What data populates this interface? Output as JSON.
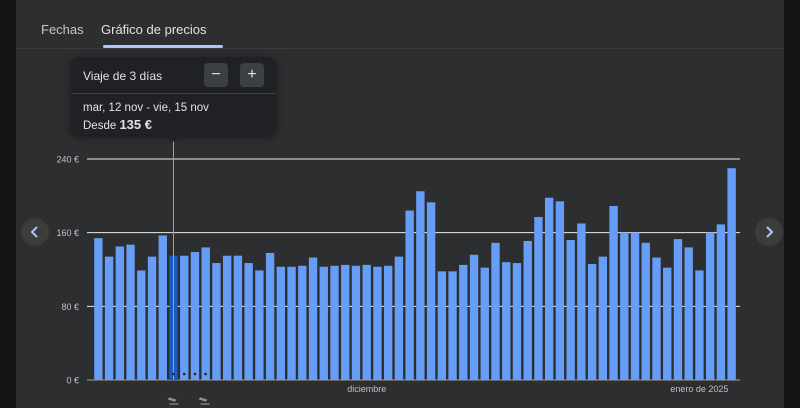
{
  "tabs": [
    {
      "label": "Fechas"
    },
    {
      "label": "Gráfico de precios"
    }
  ],
  "tooltip": {
    "trip_label": "Viaje de 3 días",
    "minus": "−",
    "plus": "+",
    "dates": "mar, 12 nov - vie, 15 nov",
    "price_prefix": "Desde",
    "price": "135 €"
  },
  "colors": {
    "bar": "#669df6",
    "selected_bar": "#1a5bc4",
    "gridline": "#e8eaed"
  },
  "icons": {
    "prev": "chevron-left-icon",
    "next": "chevron-right-icon",
    "flight": "flight-takeoff-icon"
  },
  "chart_data": {
    "type": "bar",
    "y_ticks": [
      "0 €",
      "80 €",
      "160 €",
      "240 €"
    ],
    "ylim": [
      0,
      240
    ],
    "x_labels": [
      {
        "label": "diciembre",
        "index": 25
      },
      {
        "label": "enero de 2025",
        "index": 56
      }
    ],
    "selected_index": 7,
    "values": [
      154,
      134,
      145,
      147,
      119,
      134,
      157,
      135,
      135,
      139,
      144,
      127,
      135,
      135,
      127,
      119,
      138,
      123,
      123,
      124,
      133,
      123,
      124,
      125,
      124,
      125,
      123,
      124,
      134,
      184,
      205,
      193,
      118,
      118,
      125,
      136,
      122,
      149,
      128,
      127,
      151,
      177,
      198,
      194,
      152,
      170,
      126,
      134,
      189,
      160,
      160,
      149,
      133,
      122,
      153,
      144,
      119,
      160,
      169,
      230
    ]
  }
}
